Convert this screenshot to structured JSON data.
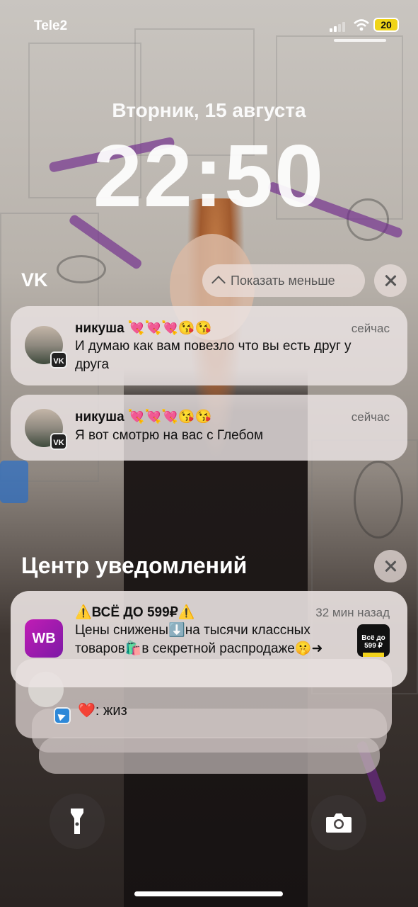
{
  "status_bar": {
    "carrier": "Tele2",
    "battery": "20"
  },
  "lock": {
    "date": "Вторник, 15 августа",
    "time": "22:50"
  },
  "vk_group": {
    "label": "VK",
    "show_less": "Показать меньше",
    "notifications": [
      {
        "sender": "никуша 💘💘💘😘😘",
        "time": "сейчас",
        "text": "И думаю как вам повезло что вы есть друг у друга",
        "app_badge": "VK"
      },
      {
        "sender": "никуша 💘💘💘😘😘",
        "time": "сейчас",
        "text": "Я вот смотрю на вас с Глебом",
        "app_badge": "VK"
      }
    ]
  },
  "notification_center": {
    "title": "Центр уведомлений",
    "wb": {
      "logo": "WB",
      "sender": "⚠️ВСЁ ДО 599₽⚠️",
      "time": "32 мин назад",
      "text": "Цены снижены⬇️на тысячи классных товаров🛍️в секретной распродаже🤫➜",
      "thumb": "Всё до 599 ₽"
    },
    "telegram": {
      "text": "❤️: жиз"
    }
  },
  "icons": {
    "flashlight": "flashlight-icon",
    "camera": "camera-icon",
    "vk_badge": "vk-icon",
    "telegram_badge": "telegram-icon"
  },
  "colors": {
    "wb_brand": "#a21ab0",
    "battery": "#f0d417",
    "telegram": "#2d88d8"
  }
}
